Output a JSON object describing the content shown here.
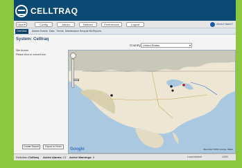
{
  "app": {
    "name": "CELLTRAQ"
  },
  "toolbar": {
    "buttons": [
      "View ▾",
      "Config",
      "Admin",
      "Refresh",
      "Preferences",
      "Logout"
    ],
    "manufacturer": "Vendor Name Product"
  },
  "tabs": [
    "Overview",
    "Alarms",
    "Events",
    "Data",
    "Trends",
    "Maintenance",
    "Recycle Bin",
    "Reports"
  ],
  "side": {
    "title": "System: Celltraq",
    "lines": [
      "Site Access",
      "Please click on colored icon"
    ],
    "create_report": "Create Report",
    "export_excel": "Export to Excel"
  },
  "filter": {
    "label": "Country",
    "value": "United States"
  },
  "map": {
    "copyright": "Map data ©2011 Google, INEGI",
    "brand": "Google"
  },
  "status": {
    "selection_label": "Selection:",
    "selection_value": "Celltraq",
    "alarms_label": "Active Alarms:",
    "alarms_value": "21",
    "warnings_label": "Active Warnings:",
    "warnings_value": "0",
    "zone": "Local intranet",
    "zoom": "100%"
  },
  "colors": {
    "brand": "#0d4a73",
    "frame": "#8dc63f"
  }
}
